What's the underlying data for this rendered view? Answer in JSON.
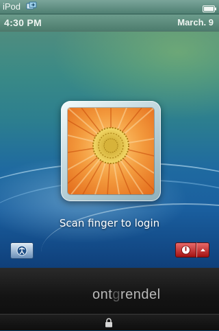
{
  "status_bar": {
    "carrier": "iPod",
    "icons": [
      "sync-icon",
      "battery-icon"
    ]
  },
  "lock_bar": {
    "time": "4:30 PM",
    "date": "March. 9"
  },
  "login": {
    "user_tile_image": "orange-gerbera-flower",
    "prompt": "Scan finger to login"
  },
  "buttons": {
    "ease_of_access_icon": "ease-of-access-icon",
    "power_icon": "power-icon",
    "power_menu_icon": "chevron-up-icon"
  },
  "branding": {
    "text_pre": "ont",
    "text_dim": "g",
    "text_post": "rendel"
  },
  "colors": {
    "power_red": "#a31212",
    "wallpaper_blue": "#1f6aa0",
    "wallpaper_green": "#4f8d7f"
  }
}
